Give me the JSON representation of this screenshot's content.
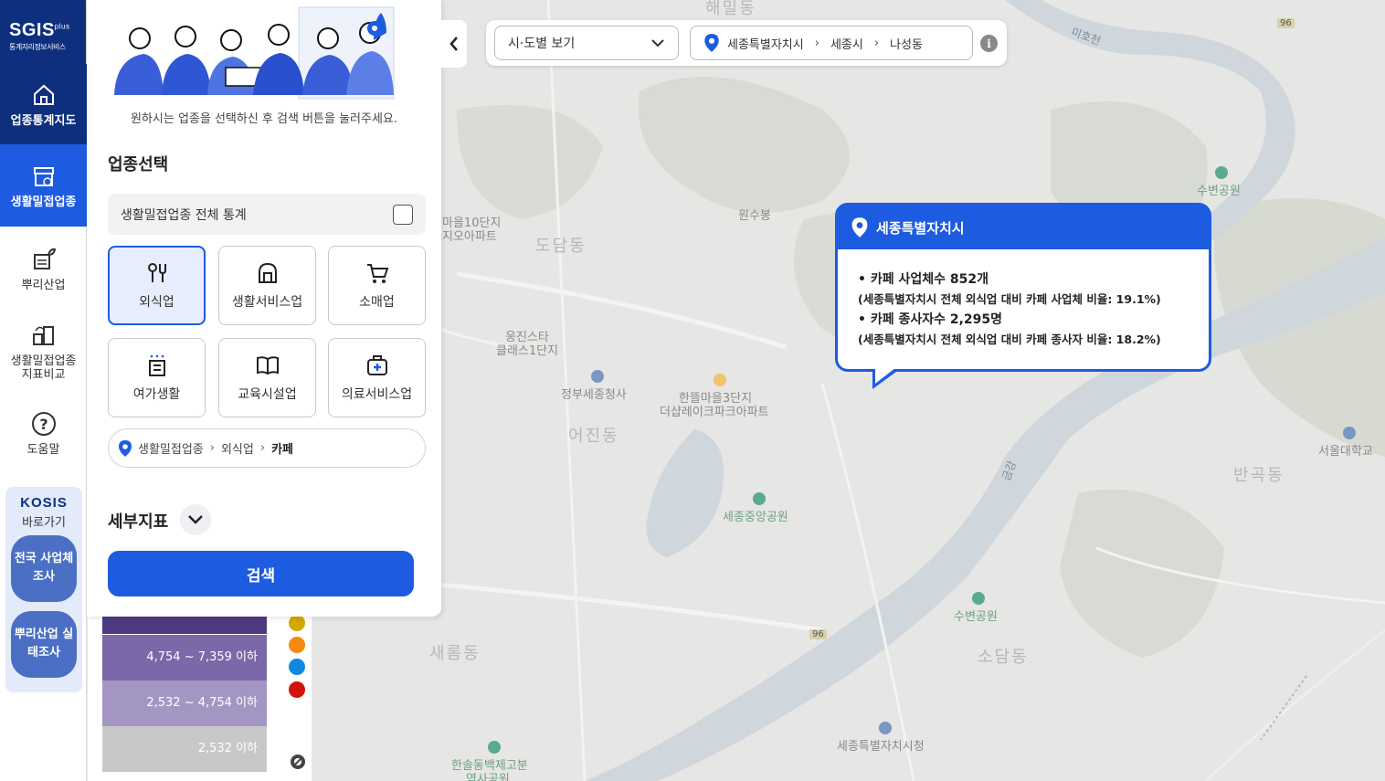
{
  "sidebar": {
    "logo_brand": "SGIS",
    "logo_plus": "plus",
    "logo_sub": "통계지리정보서비스",
    "items": [
      {
        "label": "업종통계지도"
      },
      {
        "label": "생활밀접업종"
      },
      {
        "label": "뿌리산업"
      },
      {
        "label": "생활밀접업종 지표비교"
      },
      {
        "label": "도움말"
      }
    ],
    "kosis": {
      "title": "KOSIS",
      "sub": "바로가기",
      "btn1": "전국 사업체조사",
      "btn2": "뿌리산업 실태조사"
    }
  },
  "panel": {
    "guide": "원하시는 업종을 선택하신 후 검색 버튼을 눌러주세요.",
    "section_title": "업종선택",
    "all_stat_label": "생활밀접업종 전체 통계",
    "categories": [
      {
        "label": "외식업",
        "selected": true
      },
      {
        "label": "생활서비스업",
        "selected": false
      },
      {
        "label": "소매업",
        "selected": false
      },
      {
        "label": "여가생활",
        "selected": false
      },
      {
        "label": "교육시설업",
        "selected": false
      },
      {
        "label": "의료서비스업",
        "selected": false
      }
    ],
    "breadcrumb": [
      "생활밀접업종",
      "외식업",
      "카페"
    ],
    "detail_title": "세부지표",
    "search_label": "검색"
  },
  "topbar": {
    "view_select": "시·도별 보기",
    "region": [
      "세종특별자치시",
      "세종시",
      "나성동"
    ],
    "info": "i"
  },
  "popup": {
    "title": "세종특별자치시",
    "line1": "• 카페 사업체수 852개",
    "line2": "(세종특별자치시 전체 외식업 대비 카페 사업체 비율: 19.1%)",
    "line3": "• 카페 종사자수 2,295명",
    "line4": "(세종특별자치시 전체 외식업 대비 카페 종사자 비율: 18.2%)"
  },
  "legend": {
    "ranges": [
      "4,754 ~ 7,359 이하",
      "2,532 ~ 4,754 이하",
      "2,532 이하"
    ],
    "colors": [
      "#4d3a80",
      "#7a68a8",
      "#a496c2",
      "#c8c8c8"
    ],
    "dot_colors": [
      "#d4a800",
      "#f58a0c",
      "#1188e0",
      "#d4140c"
    ]
  },
  "map_labels": {
    "top_area": "해밀동",
    "apt1_line1": "마을10단지",
    "apt1_line2": "지오아파트",
    "dodam": "도담동",
    "wonsu": "원수봉",
    "ungjin_line1": "웅진스타",
    "ungjin_line2": "클래스1단지",
    "gov": "정부세종청사",
    "hanttle_line1": "한뜰마을3단지",
    "hanttle_line2": "더샵레이크파크아파트",
    "eojin": "어진동",
    "central_park": "세종중앙공원",
    "subyeon1": "수변공원",
    "subyeon2": "수변공원",
    "seoul_univ": "서울대학교",
    "bangok": "반곡동",
    "saerom": "새롬동",
    "sodam": "소담동",
    "city_hall": "세종특별자치시청",
    "hansol_line1": "한솔동백제고분",
    "hansol_line2": "역사공원",
    "mihocheon": "미호천",
    "geum": "금강",
    "route1": "96",
    "route2": "96"
  }
}
